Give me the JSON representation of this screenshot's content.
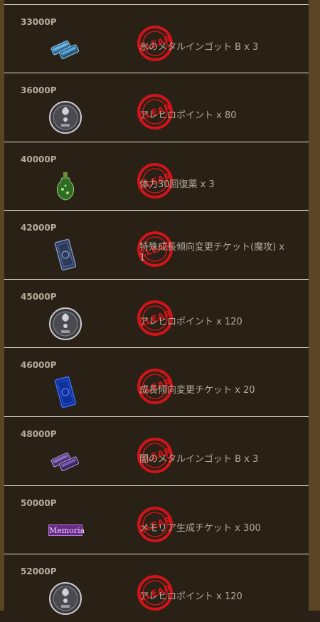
{
  "stamp_text": "CLEAR",
  "rewards": [
    {
      "points": "33000P",
      "item": "氷のメタルインゴット B x 3",
      "icon": "blue-ingot-icon"
    },
    {
      "points": "36000P",
      "item": "アレヒロポイント x 80",
      "icon": "medal-icon"
    },
    {
      "points": "40000P",
      "item": "体力30回復薬 x 3",
      "icon": "potion-icon"
    },
    {
      "points": "42000P",
      "item": "特殊成長傾向変更チケット(魔攻) x 1",
      "icon": "dark-ticket-icon"
    },
    {
      "points": "45000P",
      "item": "アレヒロポイント x 120",
      "icon": "medal-icon"
    },
    {
      "points": "46000P",
      "item": "成長傾向変更チケット x 20",
      "icon": "blue-ticket-icon"
    },
    {
      "points": "48000P",
      "item": "闇のメタルインゴット B x 3",
      "icon": "purple-ingot-icon"
    },
    {
      "points": "50000P",
      "item": "メモリア生成チケット x 300",
      "icon": "memoria-ticket-icon",
      "icon_text": "Memoria"
    },
    {
      "points": "52000P",
      "item": "アレヒロポイント x 120",
      "icon": "medal-icon"
    }
  ]
}
